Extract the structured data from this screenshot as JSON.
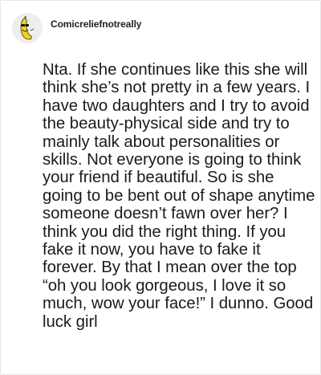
{
  "comment": {
    "username": "Comicreliefnotreally",
    "avatar_icon": "smiling-banana-avatar-icon",
    "body": "Nta. If she continues like this she will think she’s not pretty in a few years. I have two daughters and I try to avoid the beauty-physical side and try to mainly talk about personalities or skills. Not everyone is going to think your friend if beautiful. So is she going to be bent out of shape anytime someone doesn’t fawn over her? I think you did the right thing. If you fake it now, you have to fake it forever. By that I mean over the top “oh you look gorgeous, I love it so much, wow your face!” I dunno. Good luck girl"
  },
  "colors": {
    "avatar_bg": "#eeeeee",
    "banana": "#f2d21b",
    "text": "#1b1b1b"
  }
}
